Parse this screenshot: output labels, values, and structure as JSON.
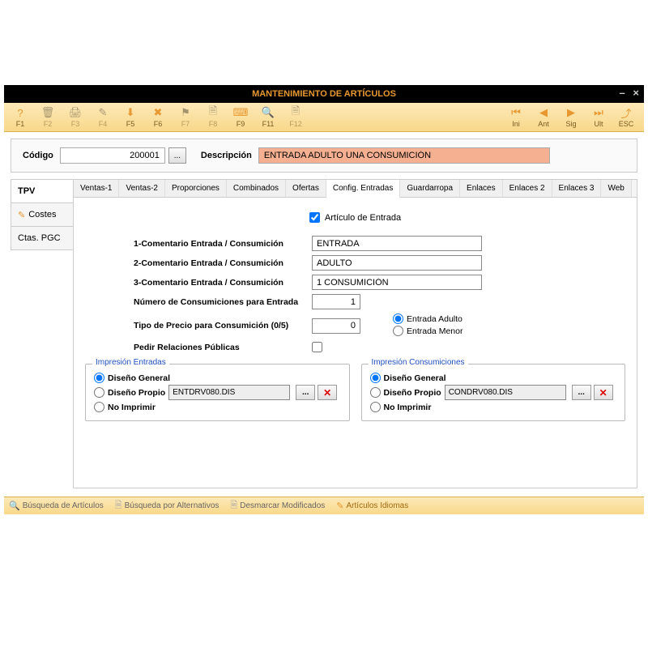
{
  "window": {
    "title": "MANTENIMIENTO DE ARTÍCULOS"
  },
  "toolbar": {
    "fkeys": [
      "F1",
      "F2",
      "F3",
      "F4",
      "F5",
      "F6",
      "F7",
      "F8",
      "F9",
      "F11",
      "F12"
    ],
    "fkeys_enabled": [
      true,
      false,
      false,
      false,
      true,
      true,
      false,
      false,
      true,
      true,
      false
    ],
    "nav": [
      "Ini",
      "Ant",
      "Sig",
      "Ult",
      "ESC"
    ]
  },
  "header": {
    "codigo_label": "Código",
    "codigo_value": "200001",
    "dots": "...",
    "descripcion_label": "Descripción",
    "descripcion_value": "ENTRADA ADULTO UNA CONSUMICIÓN"
  },
  "left_tabs": {
    "items": [
      {
        "label": "TPV",
        "icon": ""
      },
      {
        "label": "Costes",
        "icon": "✎"
      },
      {
        "label": "Ctas. PGC",
        "icon": ""
      }
    ],
    "active": 0
  },
  "top_tabs": {
    "items": [
      "Ventas-1",
      "Ventas-2",
      "Proporciones",
      "Combinados",
      "Ofertas",
      "Config. Entradas",
      "Guardarropa",
      "Enlaces",
      "Enlaces 2",
      "Enlaces 3",
      "Web"
    ],
    "active": 5
  },
  "form": {
    "articulo_entrada_label": "Artículo de Entrada",
    "articulo_entrada_checked": true,
    "rows": {
      "c1_label": "1-Comentario Entrada / Consumición",
      "c1_value": "ENTRADA",
      "c2_label": "2-Comentario Entrada / Consumición",
      "c2_value": "ADULTO",
      "c3_label": "3-Comentario Entrada / Consumición",
      "c3_value": "1 CONSUMICIÓN",
      "num_label": "Número de Consumiciones para Entrada",
      "num_value": "1",
      "tipo_label": "Tipo de Precio para Consumición (0/5)",
      "tipo_value": "0",
      "pedir_label": "Pedir Relaciones Públicas",
      "pedir_checked": false
    },
    "entry_type": {
      "adulto": "Entrada Adulto",
      "menor": "Entrada Menor",
      "selected": "adulto"
    },
    "impresion_entradas": {
      "legend": "Impresión Entradas",
      "diseno_general": "Diseño General",
      "diseno_propio": "Diseño Propio",
      "no_imprimir": "No Imprimir",
      "file": "ENTDRV080.DIS",
      "selected": "general"
    },
    "impresion_consumiciones": {
      "legend": "Impresión Consumiciones",
      "diseno_general": "Diseño General",
      "diseno_propio": "Diseño Propio",
      "no_imprimir": "No Imprimir",
      "file": "CONDRV080.DIS",
      "selected": "general"
    },
    "dots": "...",
    "x": "✕"
  },
  "statusbar": {
    "busqueda_articulos": "Búsqueda de Artículos",
    "busqueda_alternativos": "Búsqueda por Alternativos",
    "desmarcar": "Desmarcar Modificados",
    "articulos_idiomas": "Artículos Idiomas"
  }
}
